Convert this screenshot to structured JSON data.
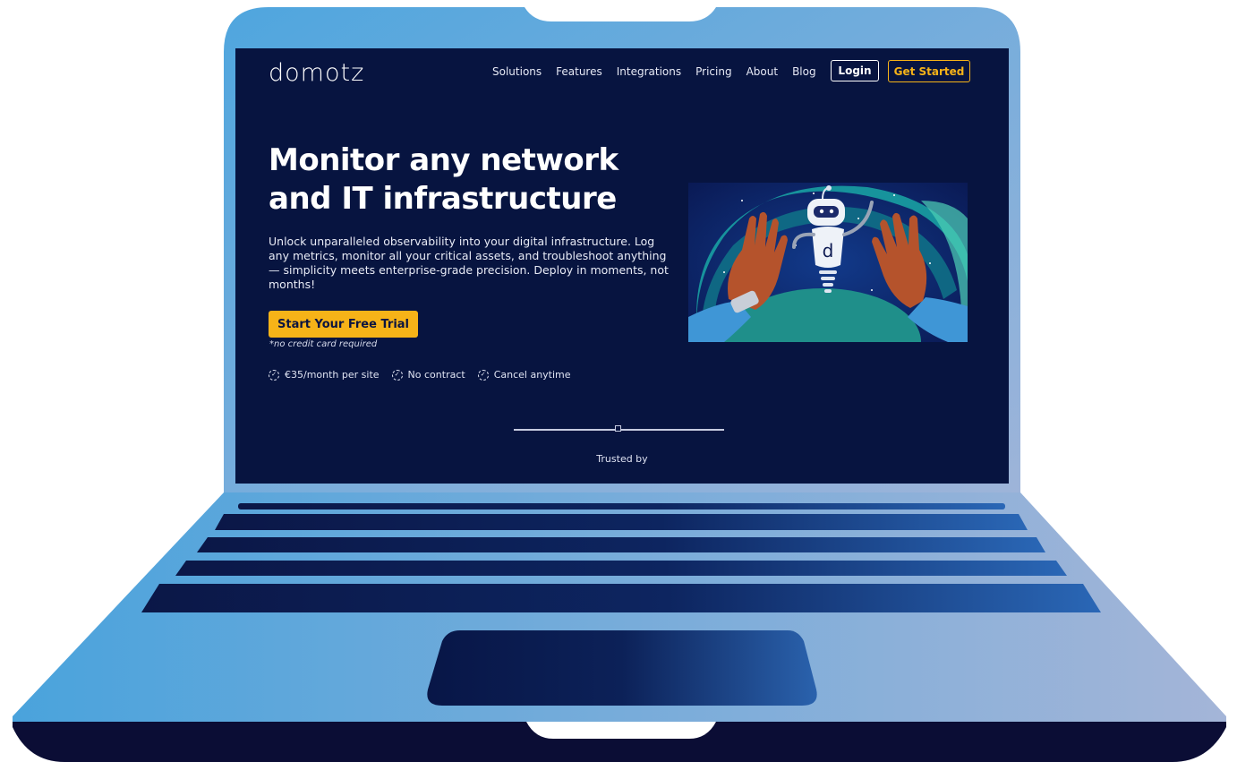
{
  "brand": {
    "logo_text": "domotz"
  },
  "nav": {
    "items": [
      "Solutions",
      "Features",
      "Integrations",
      "Pricing",
      "About",
      "Blog"
    ],
    "login_label": "Login",
    "get_started_label": "Get Started"
  },
  "hero": {
    "headline": "Monitor any network and IT infrastructure",
    "lede": "Unlock unparalleled observability into your digital infrastructure. Log any metrics, monitor all your critical assets, and troubleshoot anything — simplicity meets enterprise-grade precision. Deploy in moments, not months!",
    "cta_label": "Start Your Free Trial",
    "note": "*no credit card required",
    "perks": [
      "€35/month per site",
      "No contract",
      "Cancel anytime"
    ],
    "trusted_label": "Trusted by"
  },
  "colors": {
    "screen_bg": "#071440",
    "accent": "#f6b318",
    "laptop_light": "#4aa3dc",
    "laptop_dark": "#0b1240"
  },
  "icons": {
    "perk": "check-circle-icon",
    "illustration": "robot-high-five-illustration"
  }
}
